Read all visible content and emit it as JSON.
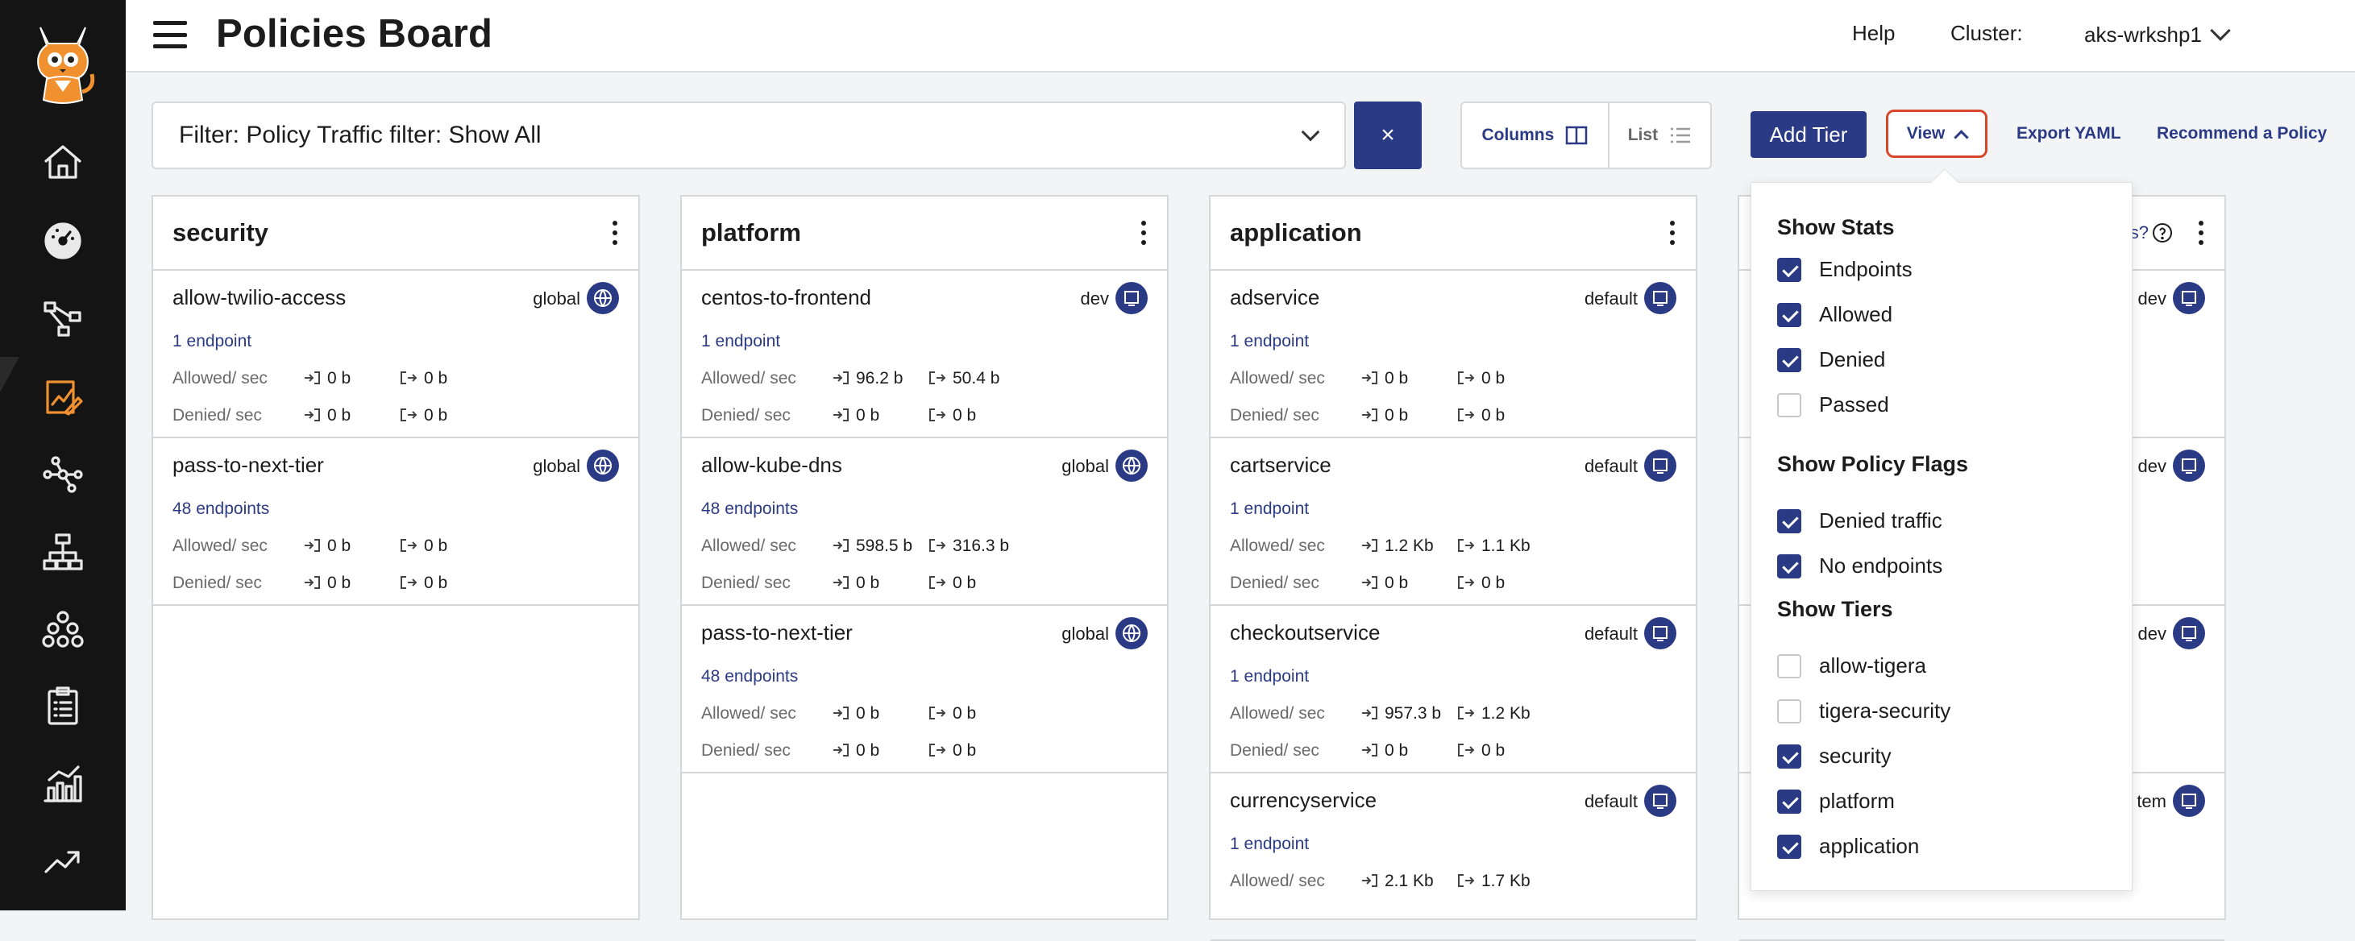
{
  "sidebar": {
    "items": [
      {
        "name": "home-icon"
      },
      {
        "name": "dashboard-icon"
      },
      {
        "name": "service-graph-icon"
      },
      {
        "name": "policies-icon",
        "active": true
      },
      {
        "name": "network-icon"
      },
      {
        "name": "hierarchy-icon"
      },
      {
        "name": "endpoints-icon"
      },
      {
        "name": "compliance-icon"
      },
      {
        "name": "reports-icon"
      },
      {
        "name": "trends-icon"
      }
    ]
  },
  "header": {
    "title": "Policies Board",
    "help": "Help",
    "cluster_label": "Cluster:",
    "cluster_value": "aks-wrkshp1"
  },
  "toolbar": {
    "filter_text": "Filter: Policy Traffic filter: Show All",
    "clear_label": "×",
    "columns_label": "Columns",
    "list_label": "List",
    "add_tier_label": "Add Tier",
    "view_label": "View",
    "export_label": "Export YAML",
    "recommend_label": "Recommend a Policy"
  },
  "stat_labels": {
    "allowed": "Allowed/ sec",
    "denied": "Denied/ sec"
  },
  "columns": [
    {
      "title": "security",
      "policies": [
        {
          "name": "allow-twilio-access",
          "ns": "global",
          "endpoints": "1 endpoint",
          "allowed_in": "0 b",
          "allowed_out": "0 b",
          "denied_in": "0 b",
          "denied_out": "0 b"
        },
        {
          "name": "pass-to-next-tier",
          "ns": "global",
          "endpoints": "48 endpoints",
          "allowed_in": "0 b",
          "allowed_out": "0 b",
          "denied_in": "0 b",
          "denied_out": "0 b"
        }
      ]
    },
    {
      "title": "platform",
      "policies": [
        {
          "name": "centos-to-frontend",
          "ns": "dev",
          "endpoints": "1 endpoint",
          "allowed_in": "96.2 b",
          "allowed_out": "50.4 b",
          "denied_in": "0 b",
          "denied_out": "0 b"
        },
        {
          "name": "allow-kube-dns",
          "ns": "global",
          "endpoints": "48 endpoints",
          "allowed_in": "598.5 b",
          "allowed_out": "316.3 b",
          "denied_in": "0 b",
          "denied_out": "0 b"
        },
        {
          "name": "pass-to-next-tier",
          "ns": "global",
          "endpoints": "48 endpoints",
          "allowed_in": "0 b",
          "allowed_out": "0 b",
          "denied_in": "0 b",
          "denied_out": "0 b"
        }
      ]
    },
    {
      "title": "application",
      "policies": [
        {
          "name": "adservice",
          "ns": "default",
          "endpoints": "1 endpoint",
          "allowed_in": "0 b",
          "allowed_out": "0 b",
          "denied_in": "0 b",
          "denied_out": "0 b"
        },
        {
          "name": "cartservice",
          "ns": "default",
          "endpoints": "1 endpoint",
          "allowed_in": "1.2 Kb",
          "allowed_out": "1.1 Kb",
          "denied_in": "0 b",
          "denied_out": "0 b"
        },
        {
          "name": "checkoutservice",
          "ns": "default",
          "endpoints": "1 endpoint",
          "allowed_in": "957.3 b",
          "allowed_out": "1.2 Kb",
          "denied_in": "0 b",
          "denied_out": "0 b"
        },
        {
          "name": "currencyservice",
          "ns": "default",
          "endpoints": "1 endpoint",
          "allowed_in": "2.1 Kb",
          "allowed_out": "1.7 Kb",
          "denied_in": "",
          "denied_out": ""
        }
      ]
    },
    {
      "title": "",
      "header_fragment": "is?",
      "policies": [
        {
          "ns": "dev"
        },
        {
          "ns": "dev"
        },
        {
          "ns": "dev"
        },
        {
          "ns": "tem"
        }
      ]
    }
  ],
  "view_menu": {
    "stats_heading": "Show Stats",
    "stats": [
      {
        "label": "Endpoints",
        "checked": true
      },
      {
        "label": "Allowed",
        "checked": true
      },
      {
        "label": "Denied",
        "checked": true
      },
      {
        "label": "Passed",
        "checked": false
      }
    ],
    "flags_heading": "Show Policy Flags",
    "flags": [
      {
        "label": "Denied traffic",
        "checked": true
      },
      {
        "label": "No endpoints",
        "checked": true
      }
    ],
    "tiers_heading": "Show Tiers",
    "tiers": [
      {
        "label": "allow-tigera",
        "checked": false
      },
      {
        "label": "tigera-security",
        "checked": false
      },
      {
        "label": "security",
        "checked": true
      },
      {
        "label": "platform",
        "checked": true
      },
      {
        "label": "application",
        "checked": true
      }
    ]
  },
  "colors": {
    "brand": "#2b3a85",
    "accent": "#f0902f",
    "highlight": "#d9472b",
    "sidebar": "#141414"
  }
}
